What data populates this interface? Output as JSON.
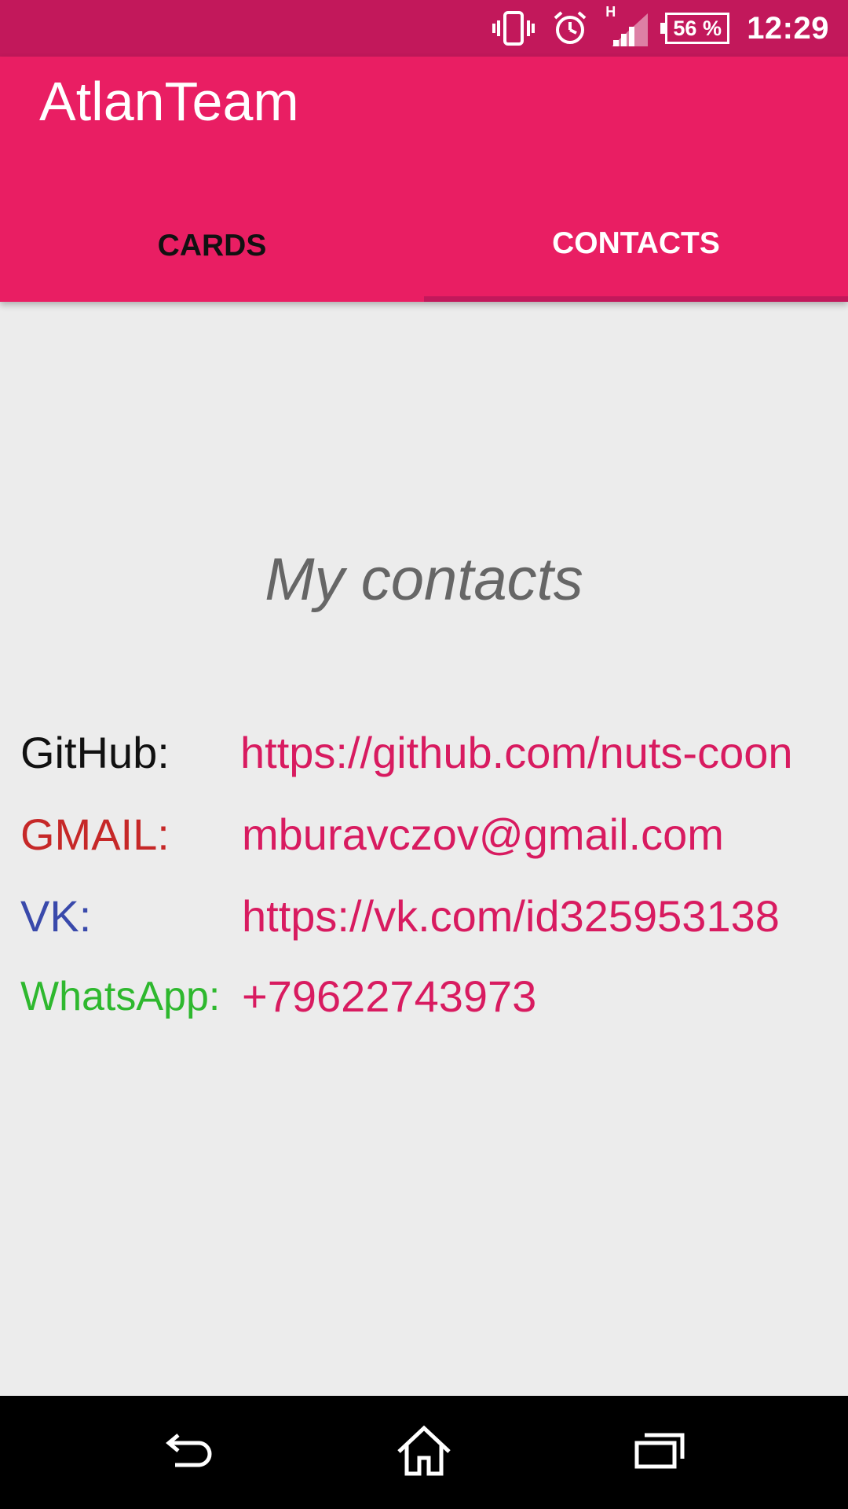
{
  "status_bar": {
    "network_label": "H",
    "battery_percent": "56 %",
    "time": "12:29",
    "icons": [
      "vibrate-icon",
      "alarm-icon",
      "signal-icon",
      "battery-icon"
    ]
  },
  "app_bar": {
    "title": "AtlanTeam",
    "tabs": [
      {
        "label": "CARDS",
        "selected": false
      },
      {
        "label": "CONTACTS",
        "selected": true
      }
    ]
  },
  "content": {
    "title": "My contacts",
    "contacts": [
      {
        "label": "GitHub:",
        "value": "https://github.com/nuts-coon",
        "label_color": "#111111"
      },
      {
        "label": "GMAIL:",
        "value": "mburavczov@gmail.com",
        "label_color": "#c62828"
      },
      {
        "label": "VK:",
        "value": "https://vk.com/id325953138",
        "label_color": "#3949ab"
      },
      {
        "label": "WhatsApp:",
        "value": "+79622743973",
        "label_color": "#2eb82e"
      }
    ]
  },
  "nav_bar": {
    "icons": [
      "back-icon",
      "home-icon",
      "recents-icon"
    ]
  },
  "colors": {
    "status_bar": "#c2185b",
    "primary": "#e91e63",
    "accent_text": "#d81b60",
    "background": "#ececec"
  }
}
